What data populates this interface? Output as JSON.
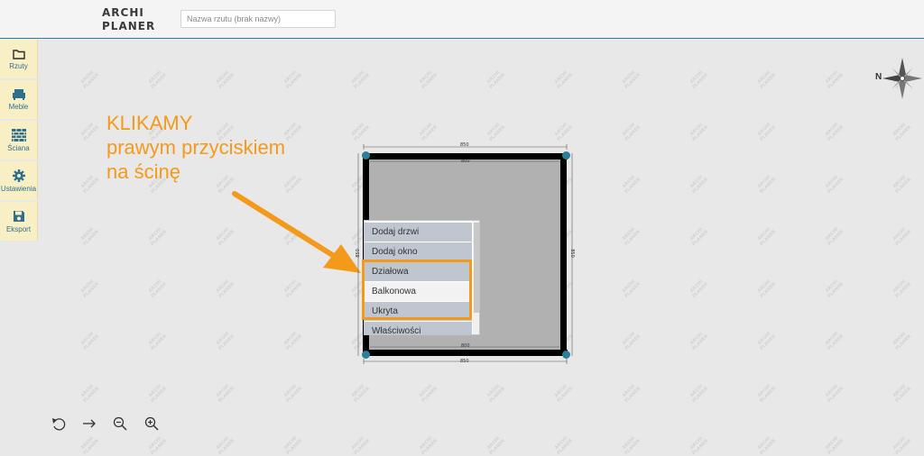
{
  "header": {
    "logo_line1": "ARCHI",
    "logo_line2": "PLANER",
    "plan_name_placeholder": "Nazwa rzutu (brak nazwy)"
  },
  "sidebar": {
    "items": [
      {
        "label": "Rzuty",
        "icon": "folder-icon"
      },
      {
        "label": "Meble",
        "icon": "armchair-icon"
      },
      {
        "label": "Ściana",
        "icon": "brick-wall-icon"
      },
      {
        "label": "Ustawienia",
        "icon": "gear-icon"
      },
      {
        "label": "Eksport",
        "icon": "floppy-disk-icon"
      }
    ]
  },
  "watermark": {
    "line1": "ARCHI",
    "line2": "PLANER"
  },
  "compass": {
    "letter": "N"
  },
  "annotation": {
    "line1": "KLIKAMY",
    "line2": "prawym przyciskiem",
    "line3": "na ścinę",
    "color": "#f39a1b"
  },
  "plan": {
    "outer_top": "850",
    "inner_top": "800",
    "outer_bottom": "850",
    "inner_bottom": "800",
    "left": "850",
    "right": "850"
  },
  "context_menu": {
    "items": [
      {
        "label": "Dodaj drzwi"
      },
      {
        "label": "Dodaj okno"
      },
      {
        "label": "Działowa"
      },
      {
        "label": "Balkonowa"
      },
      {
        "label": "Ukryta"
      },
      {
        "label": "Właściwości"
      }
    ]
  },
  "colors": {
    "accent": "#2b7f99",
    "sidebar_bg": "#f8f0c4",
    "floor": "#b1b1b1",
    "menu_item": "#bfc6cf"
  }
}
